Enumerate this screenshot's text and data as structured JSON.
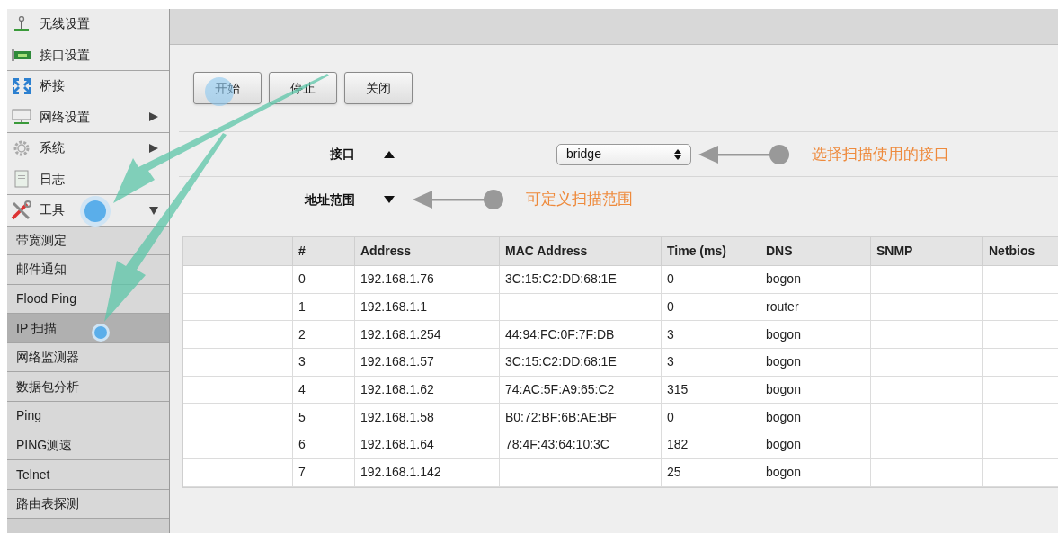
{
  "sidebar": {
    "items": [
      {
        "label": "无线设置",
        "kind": "main",
        "selected": false
      },
      {
        "label": "接口设置",
        "kind": "main",
        "selected": false
      },
      {
        "label": "桥接",
        "kind": "main",
        "selected": false
      },
      {
        "label": "网络设置",
        "kind": "main",
        "selected": false,
        "expanded": false
      },
      {
        "label": "系统",
        "kind": "main",
        "selected": false,
        "expanded": false
      },
      {
        "label": "日志",
        "kind": "main",
        "selected": false
      },
      {
        "label": "工具",
        "kind": "main",
        "selected": false,
        "expanded": true
      },
      {
        "label": "带宽测定",
        "kind": "sub",
        "selected": false
      },
      {
        "label": "邮件通知",
        "kind": "sub",
        "selected": false
      },
      {
        "label": "Flood Ping",
        "kind": "sub",
        "selected": false
      },
      {
        "label": "IP 扫描",
        "kind": "sub",
        "selected": true
      },
      {
        "label": "网络监测器",
        "kind": "sub",
        "selected": false
      },
      {
        "label": "数据包分析",
        "kind": "sub",
        "selected": false
      },
      {
        "label": "Ping",
        "kind": "sub",
        "selected": false
      },
      {
        "label": "PING测速",
        "kind": "sub",
        "selected": false
      },
      {
        "label": "Telnet",
        "kind": "sub",
        "selected": false
      },
      {
        "label": "路由表探测",
        "kind": "sub",
        "selected": false
      }
    ]
  },
  "buttons": [
    "开始",
    "停止",
    "关闭"
  ],
  "settings": [
    {
      "label": "接口",
      "expanded": true,
      "value": "bridge",
      "annotation": "选择扫描使用的接口"
    },
    {
      "label": "地址范围",
      "expanded": false,
      "annotation": "可定义扫描范围"
    }
  ],
  "table": {
    "columns": [
      "#",
      "Address",
      "MAC Address",
      "Time (ms)",
      "DNS",
      "SNMP",
      "Netbios"
    ],
    "rows": [
      {
        "index": "0",
        "address": "192.168.1.76",
        "mac": "3C:15:C2:DD:68:1E",
        "time": "0",
        "dns": "bogon"
      },
      {
        "index": "1",
        "address": "192.168.1.1",
        "time": "0",
        "dns": "router"
      },
      {
        "index": "2",
        "address": "192.168.1.254",
        "mac": "44:94:FC:0F:7F:DB",
        "time": "3",
        "dns": "bogon"
      },
      {
        "index": "3",
        "address": "192.168.1.57",
        "mac": "3C:15:C2:DD:68:1E",
        "time": "3",
        "dns": "bogon"
      },
      {
        "index": "4",
        "address": "192.168.1.62",
        "mac": "74:AC:5F:A9:65:C2",
        "time": "315",
        "dns": "bogon"
      },
      {
        "index": "5",
        "address": "192.168.1.58",
        "mac": "B0:72:BF:6B:AE:BF",
        "time": "0",
        "dns": "bogon"
      },
      {
        "index": "6",
        "address": "192.168.1.64",
        "mac": "78:4F:43:64:10:3C",
        "time": "182",
        "dns": "bogon"
      },
      {
        "index": "7",
        "address": "192.168.1.142",
        "time": "25",
        "dns": "bogon"
      }
    ]
  }
}
